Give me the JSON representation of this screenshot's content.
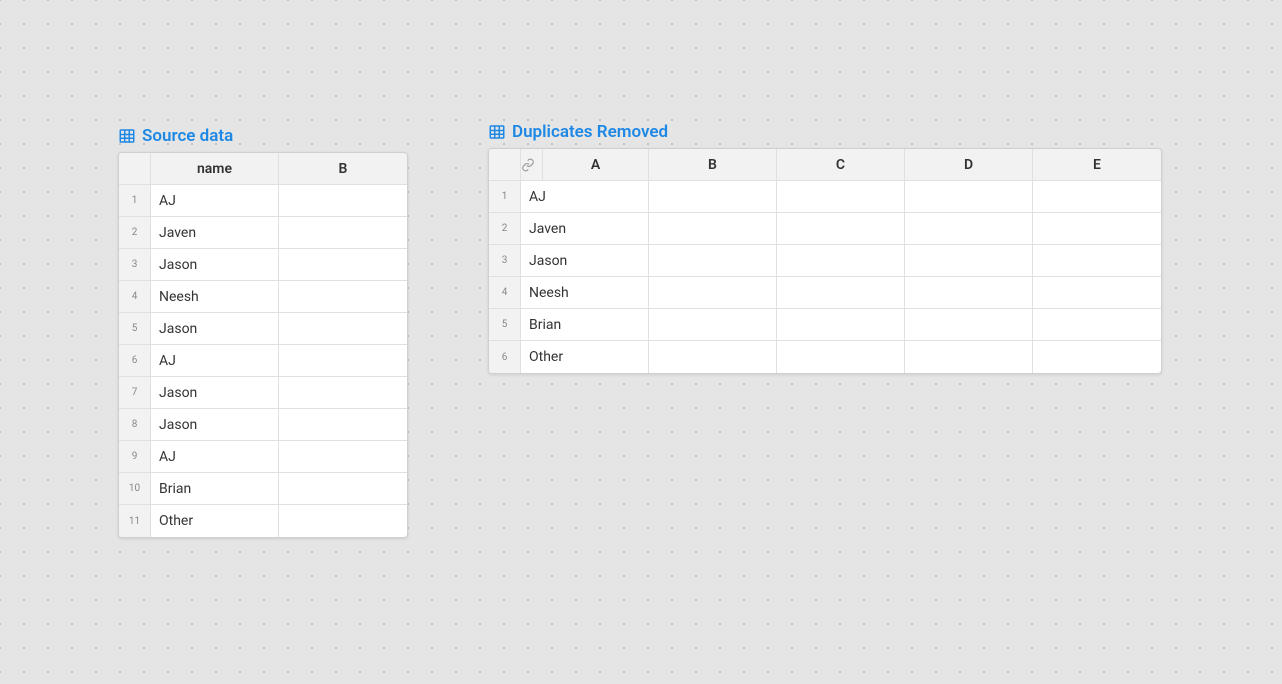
{
  "source": {
    "title": "Source data",
    "columns": [
      "name",
      "B"
    ],
    "rows": [
      {
        "num": "1",
        "cells": [
          "AJ",
          ""
        ]
      },
      {
        "num": "2",
        "cells": [
          "Javen",
          ""
        ]
      },
      {
        "num": "3",
        "cells": [
          "Jason",
          ""
        ]
      },
      {
        "num": "4",
        "cells": [
          "Neesh",
          ""
        ]
      },
      {
        "num": "5",
        "cells": [
          "Jason",
          ""
        ]
      },
      {
        "num": "6",
        "cells": [
          "AJ",
          ""
        ]
      },
      {
        "num": "7",
        "cells": [
          "Jason",
          ""
        ]
      },
      {
        "num": "8",
        "cells": [
          "Jason",
          ""
        ]
      },
      {
        "num": "9",
        "cells": [
          "AJ",
          ""
        ]
      },
      {
        "num": "10",
        "cells": [
          "Brian",
          ""
        ]
      },
      {
        "num": "11",
        "cells": [
          "Other",
          ""
        ]
      }
    ]
  },
  "duplicates": {
    "title": "Duplicates Removed",
    "columns": [
      "A",
      "B",
      "C",
      "D",
      "E"
    ],
    "rows": [
      {
        "num": "1",
        "cells": [
          "AJ",
          "",
          "",
          "",
          ""
        ]
      },
      {
        "num": "2",
        "cells": [
          "Javen",
          "",
          "",
          "",
          ""
        ]
      },
      {
        "num": "3",
        "cells": [
          "Jason",
          "",
          "",
          "",
          ""
        ]
      },
      {
        "num": "4",
        "cells": [
          "Neesh",
          "",
          "",
          "",
          ""
        ]
      },
      {
        "num": "5",
        "cells": [
          "Brian",
          "",
          "",
          "",
          ""
        ]
      },
      {
        "num": "6",
        "cells": [
          "Other",
          "",
          "",
          "",
          ""
        ]
      }
    ]
  }
}
